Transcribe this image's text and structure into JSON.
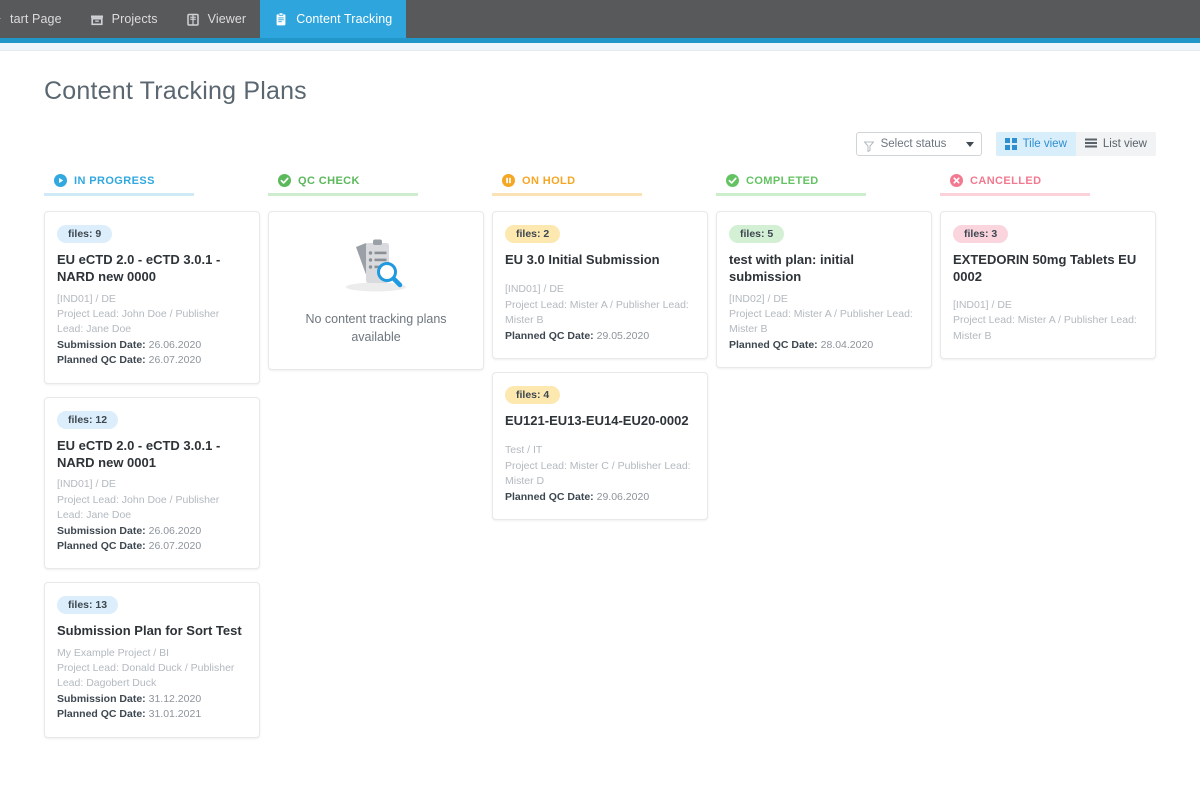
{
  "topbar": {
    "tabs": [
      {
        "label": "tart Page",
        "icon": "home-icon",
        "active": false,
        "partial": true
      },
      {
        "label": "Projects",
        "icon": "archive-box-icon",
        "active": false,
        "partial": false
      },
      {
        "label": "Viewer",
        "icon": "book-icon",
        "active": false,
        "partial": false
      },
      {
        "label": "Content Tracking",
        "icon": "clipboard-icon",
        "active": true,
        "partial": false
      }
    ],
    "accent_color": "#2196c9",
    "bar_color": "#58595b",
    "active_tab_color": "#2fa5dd"
  },
  "page": {
    "title": "Content Tracking Plans"
  },
  "toolbar": {
    "status_filter": {
      "label": "Select status",
      "icon": "funnel-icon",
      "caret": "chevron-down-icon"
    },
    "tile_view": {
      "label": "Tile view",
      "icon": "grid-icon",
      "active": true
    },
    "list_view": {
      "label": "List view",
      "icon": "list-icon",
      "active": false
    }
  },
  "board": {
    "columns": [
      {
        "status": "IN PROGRESS",
        "icon": "play-circle-icon",
        "color": "#31a8e0",
        "rule_color": "#cfe9f7",
        "empty": false,
        "empty_message": "",
        "cards": [
          {
            "badge": "files: 9",
            "badge_tone": "blue",
            "title": "EU eCTD 2.0 - eCTD 3.0.1 - NARD new 0000",
            "project": "[IND01] / DE",
            "leads": "Project Lead: John Doe / Publisher Lead: Jane Doe",
            "dates": [
              {
                "label": "Submission Date:",
                "value": "26.06.2020"
              },
              {
                "label": "Planned QC Date:",
                "value": "26.07.2020"
              }
            ]
          },
          {
            "badge": "files: 12",
            "badge_tone": "blue",
            "title": "EU eCTD 2.0 - eCTD 3.0.1 - NARD new 0001",
            "project": "[IND01] / DE",
            "leads": "Project Lead: John Doe / Publisher Lead: Jane Doe",
            "dates": [
              {
                "label": "Submission Date:",
                "value": "26.06.2020"
              },
              {
                "label": "Planned QC Date:",
                "value": "26.07.2020"
              }
            ]
          },
          {
            "badge": "files: 13",
            "badge_tone": "blue",
            "title": "Submission Plan for Sort Test",
            "project": "My Example Project / BI",
            "leads": "Project Lead: Donald Duck / Publisher Lead: Dagobert Duck",
            "dates": [
              {
                "label": "Submission Date:",
                "value": "31.12.2020"
              },
              {
                "label": "Planned QC Date:",
                "value": "31.01.2021"
              }
            ]
          }
        ]
      },
      {
        "status": "QC CHECK",
        "icon": "check-circle-icon",
        "color": "#5bb85b",
        "rule_color": "#cfeccf",
        "empty": true,
        "empty_message": "No content tracking plans available",
        "cards": []
      },
      {
        "status": "ON HOLD",
        "icon": "pause-circle-icon",
        "color": "#f5a623",
        "rule_color": "#fbe2b4",
        "empty": false,
        "empty_message": "",
        "cards": [
          {
            "badge": "files: 2",
            "badge_tone": "amber",
            "title": "EU 3.0 Initial Submission",
            "project": "[IND01] / DE",
            "leads": "Project Lead: Mister A / Publisher Lead: Mister B",
            "dates": [
              {
                "label": "Planned QC Date:",
                "value": "29.05.2020"
              }
            ]
          },
          {
            "badge": "files: 4",
            "badge_tone": "amber",
            "title": "EU121-EU13-EU14-EU20-0002",
            "project": "Test / IT",
            "leads": "Project Lead: Mister C / Publisher Lead: Mister D",
            "dates": [
              {
                "label": "Planned QC Date:",
                "value": "29.06.2020"
              }
            ]
          }
        ]
      },
      {
        "status": "COMPLETED",
        "icon": "check-circle-icon",
        "color": "#63c363",
        "rule_color": "#cdeecd",
        "empty": false,
        "empty_message": "",
        "cards": [
          {
            "badge": "files: 5",
            "badge_tone": "green",
            "title": "test with plan: initial submission",
            "project": "[IND02] / DE",
            "leads": "Project Lead: Mister A / Publisher Lead: Mister B",
            "dates": [
              {
                "label": "Planned QC Date:",
                "value": "28.04.2020"
              }
            ]
          }
        ]
      },
      {
        "status": "CANCELLED",
        "icon": "times-circle-icon",
        "color": "#f2798f",
        "rule_color": "#fbd2da",
        "empty": false,
        "empty_message": "",
        "cards": [
          {
            "badge": "files: 3",
            "badge_tone": "pink",
            "title": "EXTEDORIN 50mg Tablets EU 0002",
            "project": "[IND01] / DE",
            "leads": "Project Lead: Mister A / Publisher Lead: Mister B",
            "dates": []
          }
        ]
      }
    ]
  }
}
